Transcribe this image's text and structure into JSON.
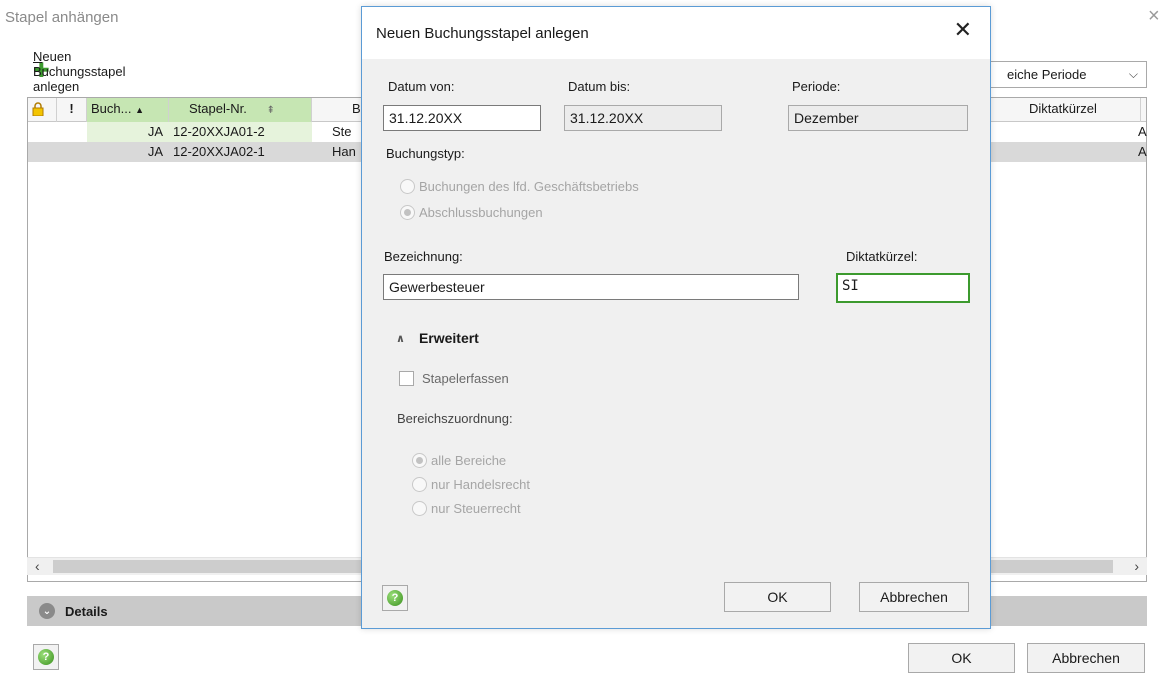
{
  "background_window": {
    "title": "Stapel anhängen",
    "close_glyph": "×",
    "new_stack_prefix": "N",
    "new_stack_rest": "euen Buchungsstapel anlegen",
    "period_select_value": "eiche Periode",
    "columns": {
      "buch": "Buch...",
      "stapel_nr": "Stapel-Nr.",
      "b": "B",
      "diktatkuerzel": "Diktatkürzel"
    },
    "rows": [
      {
        "buch": "JA",
        "stapel_nr": "12-20XXJA01-2",
        "bez": "Ste",
        "end": "A"
      },
      {
        "buch": "JA",
        "stapel_nr": "12-20XXJA02-1",
        "bez": "Han",
        "end": "A"
      }
    ],
    "details_label": "Details",
    "ok_label": "OK",
    "cancel_label": "Abbrechen",
    "help_glyph": "?"
  },
  "dialog": {
    "title": "Neuen Buchungsstapel anlegen",
    "close_glyph": "✕",
    "datum_von_label": "Datum von:",
    "datum_von_value": "31.12.20XX",
    "datum_bis_label": "Datum bis:",
    "datum_bis_value": "31.12.20XX",
    "periode_label": "Periode:",
    "periode_value": "Dezember",
    "buchungstyp_label": "Buchungstyp:",
    "buchungstyp_options": [
      "Buchungen des lfd. Geschäftsbetriebs",
      "Abschlussbuchungen"
    ],
    "bezeichnung_label": "Bezeichnung:",
    "bezeichnung_value": "Gewerbesteuer",
    "diktat_label": "Diktatkürzel:",
    "diktat_value": "SI",
    "erweitert_label": "Erweitert",
    "stapelerfassen_label": "Stapelerfassen",
    "bereich_label": "Bereichszuordnung:",
    "bereich_options": [
      "alle Bereiche",
      "nur Handelsrecht",
      "nur Steuerrecht"
    ],
    "ok_label": "OK",
    "cancel_label": "Abbrechen",
    "help_glyph": "?"
  },
  "colors": {
    "accent_green": "#3c9a2e",
    "dialog_border": "#5b9bd5",
    "header_green": "#c6e6b3"
  }
}
